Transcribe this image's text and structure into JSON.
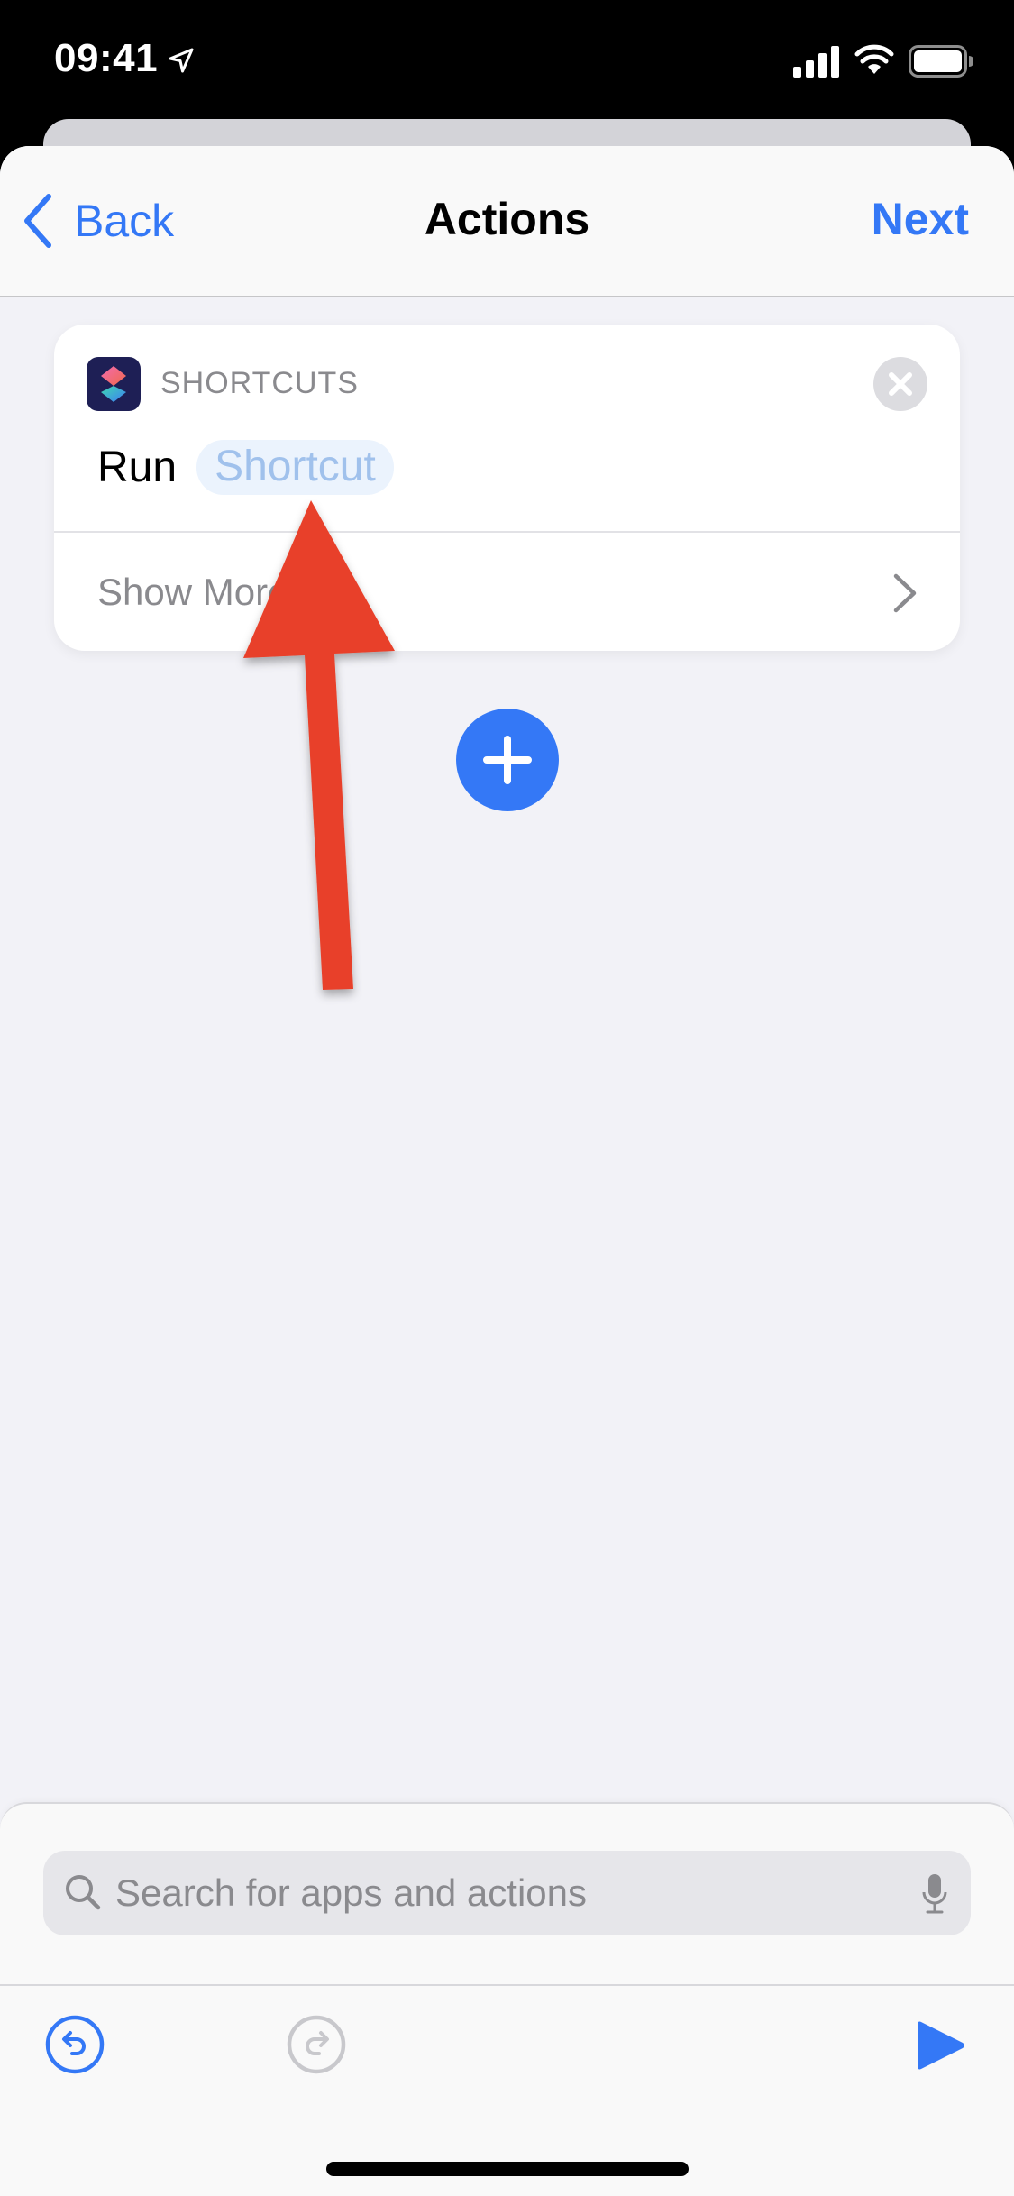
{
  "status_bar": {
    "time": "09:41",
    "icons": [
      "location-arrow-icon",
      "cellular-signal-icon",
      "wifi-icon",
      "battery-icon"
    ]
  },
  "nav": {
    "back_label": "Back",
    "title": "Actions",
    "next_label": "Next"
  },
  "action_card": {
    "app_name": "SHORTCUTS",
    "app_icon": "shortcuts-app-icon",
    "verb": "Run",
    "parameter_placeholder": "Shortcut",
    "show_more_label": "Show More",
    "close_icon": "close-icon",
    "chevron_icon": "chevron-right-icon"
  },
  "add_button": {
    "icon": "plus-icon"
  },
  "annotation": {
    "type": "arrow",
    "color": "#e8412a",
    "points_to": "Shortcut"
  },
  "search": {
    "placeholder": "Search for apps and actions",
    "value": ""
  },
  "toolbar": {
    "undo_icon": "undo-icon",
    "redo_icon": "redo-icon",
    "run_icon": "play-icon",
    "redo_enabled": false
  },
  "colors": {
    "accent": "#3478f6",
    "background": "#f2f2f7",
    "secondary_text": "#8a8a8e",
    "parameter_text": "#a0c1ec",
    "parameter_bg": "#ebf3fd",
    "arrow": "#e8412a"
  }
}
